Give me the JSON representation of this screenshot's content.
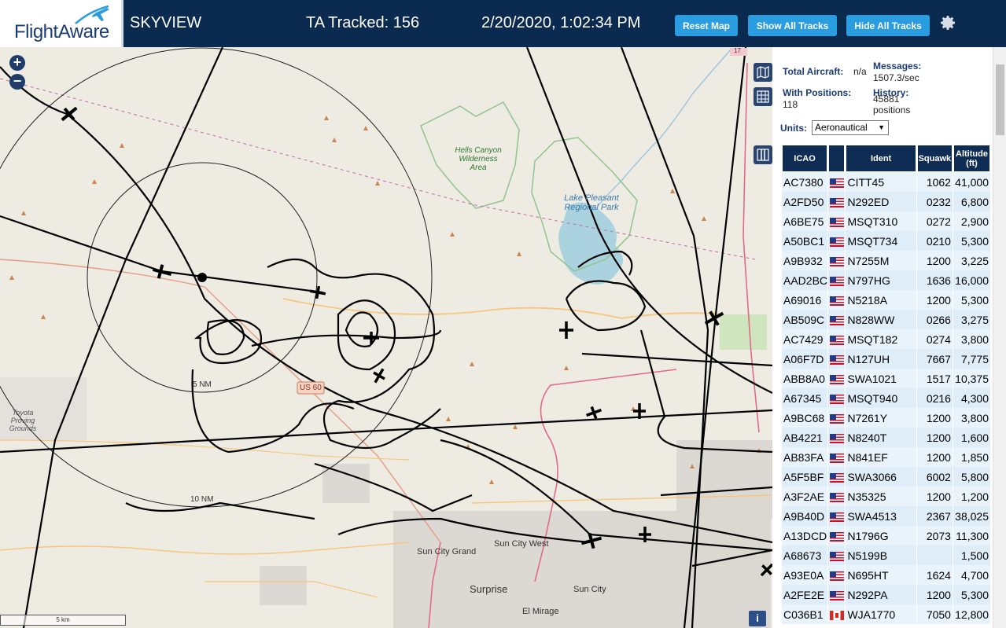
{
  "header": {
    "logo": "FlightAware",
    "title": "SKYVIEW",
    "tracked": "TA Tracked: 156",
    "clock": "2/20/2020, 1:02:34 PM",
    "reset_label": "Reset Map",
    "show_all_label": "Show All Tracks",
    "hide_all_label": "Hide All Tracks"
  },
  "map": {
    "zoom_in": "+",
    "zoom_out": "−",
    "ring_5": "5 NM",
    "ring_10": "10 NM",
    "labels": {
      "hells_canyon": "Hells Canyon Wilderness Area",
      "lake_pleasant": "Lake Pleasant Regional Park",
      "toyota": "Toyota Proving Grounds",
      "us60": "US 60",
      "sun_city_west": "Sun City West",
      "sun_city_grand": "Sun City Grand",
      "surprise": "Surprise",
      "sun_city": "Sun City",
      "el_mirage": "El Mirage",
      "i17": "17"
    },
    "info": "i",
    "scale": "5 km"
  },
  "stats": {
    "total_label": "Total Aircraft:",
    "total_value": "n/a",
    "messages_label": "Messages:",
    "messages_value": "1507.3/sec",
    "positions_label": "With Positions:",
    "positions_value": "118",
    "history_label": "History:",
    "history_value": "45881 positions",
    "units_label": "Units:",
    "units_value": "Aeronautical"
  },
  "table": {
    "headers": [
      "ICAO",
      "",
      "Ident",
      "Squawk",
      "Altitude (ft)"
    ],
    "rows": [
      {
        "icao": "AC7380",
        "country": "US",
        "ident": "CITT45",
        "squawk": "1062",
        "alt": "41,000"
      },
      {
        "icao": "A2FD50",
        "country": "US",
        "ident": "N292ED",
        "squawk": "0232",
        "alt": "6,800"
      },
      {
        "icao": "A6BE75",
        "country": "US",
        "ident": "MSQT310",
        "squawk": "0272",
        "alt": "2,900"
      },
      {
        "icao": "A50BC1",
        "country": "US",
        "ident": "MSQT734",
        "squawk": "0210",
        "alt": "5,300"
      },
      {
        "icao": "A9B932",
        "country": "US",
        "ident": "N7255M",
        "squawk": "1200",
        "alt": "3,225"
      },
      {
        "icao": "AAD2BC",
        "country": "US",
        "ident": "N797HG",
        "squawk": "1636",
        "alt": "16,000"
      },
      {
        "icao": "A69016",
        "country": "US",
        "ident": "N5218A",
        "squawk": "1200",
        "alt": "5,300"
      },
      {
        "icao": "AB509C",
        "country": "US",
        "ident": "N828WW",
        "squawk": "0266",
        "alt": "3,275"
      },
      {
        "icao": "AC7429",
        "country": "US",
        "ident": "MSQT182",
        "squawk": "0274",
        "alt": "3,800"
      },
      {
        "icao": "A06F7D",
        "country": "US",
        "ident": "N127UH",
        "squawk": "7667",
        "alt": "7,775"
      },
      {
        "icao": "ABB8A0",
        "country": "US",
        "ident": "SWA1021",
        "squawk": "1517",
        "alt": "10,375"
      },
      {
        "icao": "A67345",
        "country": "US",
        "ident": "MSQT940",
        "squawk": "0216",
        "alt": "4,300"
      },
      {
        "icao": "A9BC68",
        "country": "US",
        "ident": "N7261Y",
        "squawk": "1200",
        "alt": "3,800"
      },
      {
        "icao": "AB4221",
        "country": "US",
        "ident": "N8240T",
        "squawk": "1200",
        "alt": "1,600"
      },
      {
        "icao": "AB83FA",
        "country": "US",
        "ident": "N841EF",
        "squawk": "1200",
        "alt": "1,850"
      },
      {
        "icao": "A5F5BF",
        "country": "US",
        "ident": "SWA3066",
        "squawk": "6002",
        "alt": "5,800"
      },
      {
        "icao": "A3F2AE",
        "country": "US",
        "ident": "N35325",
        "squawk": "1200",
        "alt": "1,200"
      },
      {
        "icao": "A9B40D",
        "country": "US",
        "ident": "SWA4513",
        "squawk": "2367",
        "alt": "38,025"
      },
      {
        "icao": "A13DCD",
        "country": "US",
        "ident": "N1796G",
        "squawk": "2073",
        "alt": "11,300"
      },
      {
        "icao": "A68673",
        "country": "US",
        "ident": "N5199B",
        "squawk": "",
        "alt": "1,500"
      },
      {
        "icao": "A93E0A",
        "country": "US",
        "ident": "N695HT",
        "squawk": "1624",
        "alt": "4,700"
      },
      {
        "icao": "A2FE2E",
        "country": "US",
        "ident": "N292PA",
        "squawk": "1200",
        "alt": "5,300"
      },
      {
        "icao": "C036B1",
        "country": "CA",
        "ident": "WJA1770",
        "squawk": "7050",
        "alt": "12,800"
      }
    ]
  },
  "colors": {
    "header_bg": "#0b2a4f",
    "button": "#2a9ce0",
    "track": "#000000",
    "map_bg": "#eeebe3",
    "water": "#aad3df"
  }
}
